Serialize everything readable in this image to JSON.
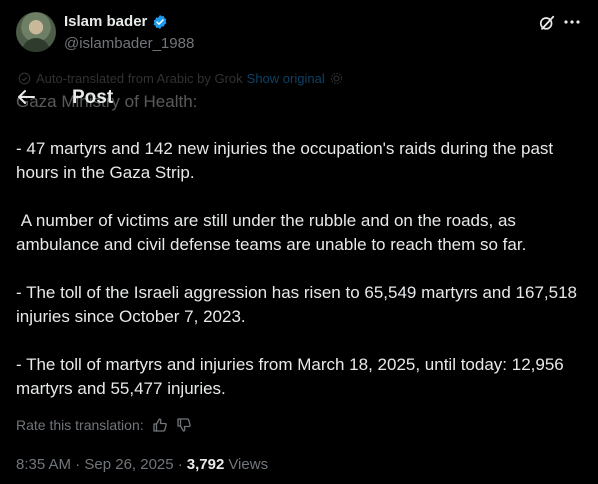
{
  "author": {
    "name": "Islam bader",
    "handle": "@islambader_1988",
    "verified": true
  },
  "header": {
    "title": "Post"
  },
  "translation": {
    "notice": "Auto-translated from Arabic by Grok",
    "show_original": "Show original"
  },
  "post": {
    "first_line": "Gaza Ministry of Health:",
    "paragraphs": [
      "- 47 martyrs and 142 new injuries the occupation's raids during the past hours in the Gaza Strip.",
      " A number of victims are still under the rubble and on the roads, as ambulance and civil defense teams are unable to reach them so far.",
      "- The toll of the Israeli aggression has risen to 65,549 martyrs and 167,518 injuries since October 7, 2023.",
      "- The toll of martyrs and injuries from March 18, 2025, until today: 12,956 martyrs and 55,477 injuries."
    ]
  },
  "rate": {
    "label": "Rate this translation:"
  },
  "meta": {
    "timestamp": "8:35 AM · Sep 26, 2025 ·",
    "views_count": "3,792",
    "views_label": "Views"
  },
  "colors": {
    "background": "#000000",
    "text": "#e7e9ea",
    "muted": "#71767b",
    "accent": "#1d9bf0"
  },
  "icons": [
    "verified-badge-icon",
    "grok-icon",
    "more-icon",
    "back-arrow-icon",
    "translate-icon",
    "gear-icon",
    "thumbs-up-icon",
    "thumbs-down-icon"
  ]
}
